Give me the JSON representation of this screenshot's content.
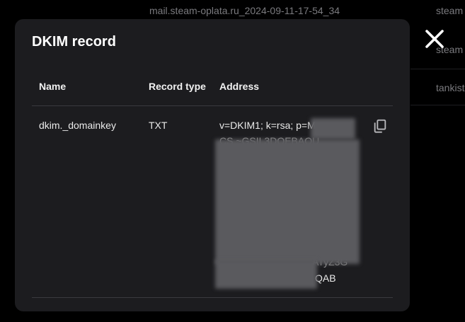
{
  "background": {
    "row1_filename": "mail.steam-oplata.ru_2024-09-11-17-54_34",
    "row1_col2": "steam",
    "row2_col2": "steam",
    "row3_col2": "tankist"
  },
  "modal": {
    "title": "DKIM record",
    "headers": {
      "name": "Name",
      "record_type": "Record type",
      "address": "Address"
    },
    "record": {
      "name": "dkim._domainkey",
      "type": "TXT",
      "address_visible_start": "v=DKIM1; k=rsa; p=M",
      "address_fragment_2": "CS  ~GSIL3DQEBAQU",
      "address_fragment_3": "ATyZ3G",
      "address_end": "QAB"
    }
  },
  "icons": {
    "copy": "copy-icon",
    "close": "close-icon"
  },
  "colors": {
    "modal_bg": "#1c1c1f",
    "page_bg": "#000000",
    "divider": "#3a3a3f"
  }
}
